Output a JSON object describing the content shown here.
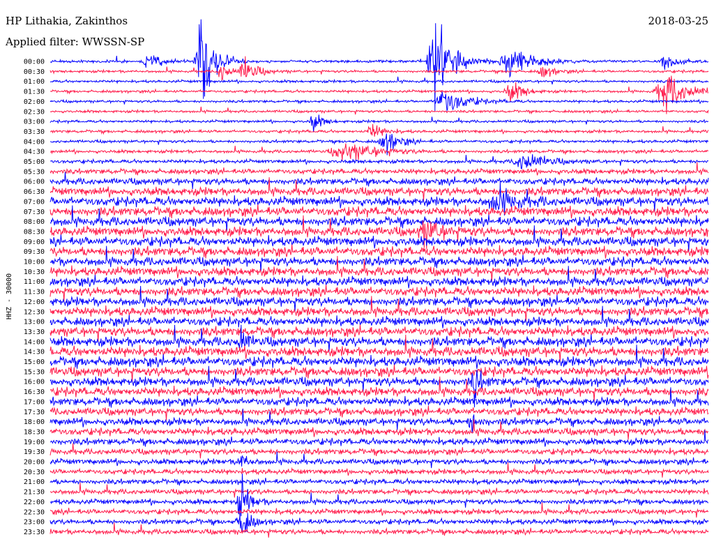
{
  "header": {
    "station": "HP Lithakia, Zakinthos",
    "filter": "Applied filter: WWSSN-SP",
    "date": "2018-03-25"
  },
  "chart_data": {
    "type": "line",
    "title": "HP Lithakia, Zakinthos",
    "subtitle": "Applied filter: WWSSN-SP",
    "date": "2018-03-25",
    "ylabel": "HHZ - 30000",
    "xlabel": "",
    "grid": false,
    "trace_colors": [
      "#0000ff",
      "#ff1a4a"
    ],
    "row_labels": [
      "00:00",
      "00:30",
      "01:00",
      "01:30",
      "02:00",
      "02:30",
      "03:00",
      "03:30",
      "04:00",
      "04:30",
      "05:00",
      "05:30",
      "06:00",
      "06:30",
      "07:00",
      "07:30",
      "08:00",
      "08:30",
      "09:00",
      "09:30",
      "10:00",
      "10:30",
      "11:00",
      "11:30",
      "12:00",
      "12:30",
      "13:00",
      "13:30",
      "14:00",
      "14:30",
      "15:00",
      "15:30",
      "16:00",
      "16:30",
      "17:00",
      "17:30",
      "18:00",
      "18:30",
      "19:00",
      "19:30",
      "20:00",
      "20:30",
      "21:00",
      "21:30",
      "22:00",
      "22:30",
      "23:00",
      "23:30"
    ],
    "noise_level": [
      0.18,
      0.18,
      0.18,
      0.18,
      0.18,
      0.18,
      0.18,
      0.2,
      0.2,
      0.22,
      0.25,
      0.35,
      0.45,
      0.55,
      0.6,
      0.62,
      0.62,
      0.62,
      0.62,
      0.62,
      0.6,
      0.6,
      0.6,
      0.6,
      0.6,
      0.6,
      0.6,
      0.62,
      0.64,
      0.65,
      0.65,
      0.62,
      0.6,
      0.58,
      0.55,
      0.52,
      0.5,
      0.48,
      0.45,
      0.4,
      0.38,
      0.35,
      0.35,
      0.35,
      0.35,
      0.35,
      0.35,
      0.35
    ],
    "events": [
      {
        "row": 0,
        "x": 0.23,
        "amp": 5.5,
        "width": 0.012
      },
      {
        "row": 0,
        "x": 0.585,
        "amp": 6.0,
        "width": 0.015
      },
      {
        "row": 0,
        "x": 0.15,
        "amp": 1.2,
        "width": 0.01
      },
      {
        "row": 0,
        "x": 0.7,
        "amp": 1.6,
        "width": 0.02
      },
      {
        "row": 0,
        "x": 0.935,
        "amp": 1.2,
        "width": 0.01
      },
      {
        "row": 1,
        "x": 0.26,
        "amp": 1.2,
        "width": 0.008
      },
      {
        "row": 1,
        "x": 0.295,
        "amp": 1.4,
        "width": 0.012
      },
      {
        "row": 1,
        "x": 0.75,
        "amp": 0.8,
        "width": 0.01
      },
      {
        "row": 3,
        "x": 0.935,
        "amp": 2.2,
        "width": 0.02
      },
      {
        "row": 3,
        "x": 0.7,
        "amp": 1.2,
        "width": 0.012
      },
      {
        "row": 4,
        "x": 0.6,
        "amp": 1.5,
        "width": 0.02
      },
      {
        "row": 6,
        "x": 0.4,
        "amp": 1.1,
        "width": 0.008
      },
      {
        "row": 7,
        "x": 0.49,
        "amp": 0.9,
        "width": 0.01
      },
      {
        "row": 8,
        "x": 0.51,
        "amp": 1.5,
        "width": 0.012
      },
      {
        "row": 9,
        "x": 0.45,
        "amp": 1.0,
        "width": 0.03
      },
      {
        "row": 10,
        "x": 0.72,
        "amp": 1.1,
        "width": 0.02
      },
      {
        "row": 14,
        "x": 0.68,
        "amp": 1.2,
        "width": 0.02
      },
      {
        "row": 17,
        "x": 0.57,
        "amp": 1.3,
        "width": 0.015
      },
      {
        "row": 28,
        "x": 0.29,
        "amp": 1.6,
        "width": 0.006
      },
      {
        "row": 32,
        "x": 0.645,
        "amp": 2.0,
        "width": 0.006
      },
      {
        "row": 36,
        "x": 0.64,
        "amp": 1.5,
        "width": 0.006
      },
      {
        "row": 40,
        "x": 0.29,
        "amp": 1.2,
        "width": 0.006
      },
      {
        "row": 44,
        "x": 0.29,
        "amp": 2.5,
        "width": 0.008
      },
      {
        "row": 46,
        "x": 0.29,
        "amp": 2.0,
        "width": 0.008
      }
    ]
  }
}
